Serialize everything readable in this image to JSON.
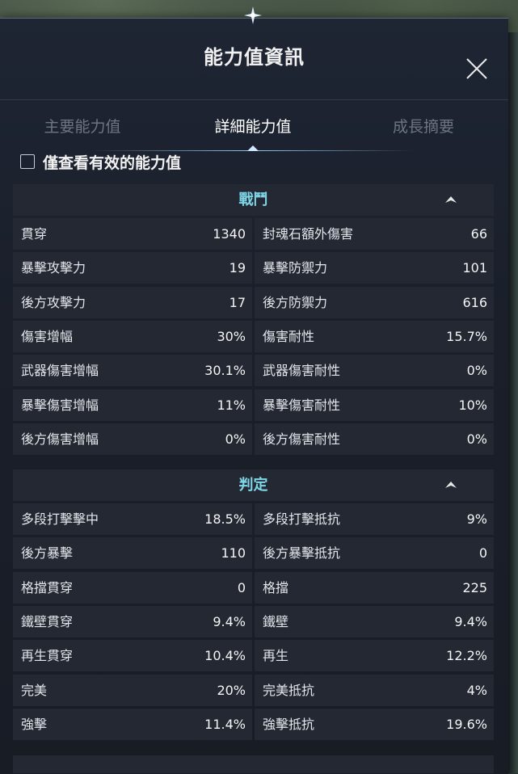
{
  "window": {
    "title": "能力值資訊",
    "close_icon": "close-icon"
  },
  "tabs": [
    {
      "label": "主要能力值",
      "active": false
    },
    {
      "label": "詳細能力值",
      "active": true
    },
    {
      "label": "成長摘要",
      "active": false
    }
  ],
  "filter": {
    "label": "僅查看有效的能力值",
    "checked": false
  },
  "sections": [
    {
      "title": "戰鬥",
      "rows": [
        {
          "left": {
            "label": "貫穿",
            "value": "1340"
          },
          "right": {
            "label": "封魂石額外傷害",
            "value": "66"
          }
        },
        {
          "left": {
            "label": "暴擊攻擊力",
            "value": "19"
          },
          "right": {
            "label": "暴擊防禦力",
            "value": "101"
          }
        },
        {
          "left": {
            "label": "後方攻擊力",
            "value": "17"
          },
          "right": {
            "label": "後方防禦力",
            "value": "616"
          }
        },
        {
          "left": {
            "label": "傷害增幅",
            "value": "30%"
          },
          "right": {
            "label": "傷害耐性",
            "value": "15.7%"
          }
        },
        {
          "left": {
            "label": "武器傷害增幅",
            "value": "30.1%"
          },
          "right": {
            "label": "武器傷害耐性",
            "value": "0%"
          }
        },
        {
          "left": {
            "label": "暴擊傷害增幅",
            "value": "11%"
          },
          "right": {
            "label": "暴擊傷害耐性",
            "value": "10%"
          }
        },
        {
          "left": {
            "label": "後方傷害增幅",
            "value": "0%"
          },
          "right": {
            "label": "後方傷害耐性",
            "value": "0%"
          }
        }
      ]
    },
    {
      "title": "判定",
      "rows": [
        {
          "left": {
            "label": "多段打擊擊中",
            "value": "18.5%"
          },
          "right": {
            "label": "多段打擊抵抗",
            "value": "9%"
          }
        },
        {
          "left": {
            "label": "後方暴擊",
            "value": "110"
          },
          "right": {
            "label": "後方暴擊抵抗",
            "value": "0"
          }
        },
        {
          "left": {
            "label": "格擋貫穿",
            "value": "0"
          },
          "right": {
            "label": "格擋",
            "value": "225"
          }
        },
        {
          "left": {
            "label": "鐵壁貫穿",
            "value": "9.4%"
          },
          "right": {
            "label": "鐵壁",
            "value": "9.4%"
          }
        },
        {
          "left": {
            "label": "再生貫穿",
            "value": "10.4%"
          },
          "right": {
            "label": "再生",
            "value": "12.2%"
          }
        },
        {
          "left": {
            "label": "完美",
            "value": "20%"
          },
          "right": {
            "label": "完美抵抗",
            "value": "4%"
          }
        },
        {
          "left": {
            "label": "強擊",
            "value": "11.4%"
          },
          "right": {
            "label": "強擊抵抗",
            "value": "19.6%"
          }
        }
      ]
    }
  ],
  "colors": {
    "section_title": "#7ed6e6",
    "panel_bg": "#1a1f2a",
    "cell_bg": "#232833",
    "active_tab": "#ffffff",
    "inactive_tab": "#6d7583"
  }
}
